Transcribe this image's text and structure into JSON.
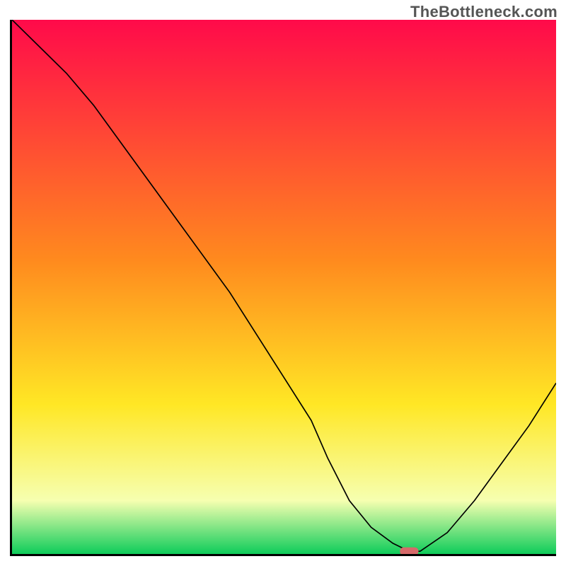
{
  "watermark": "TheBottleneck.com",
  "colors": {
    "gradient_top": "#ff0a4a",
    "gradient_mid1": "#ff8a1e",
    "gradient_mid2": "#ffe725",
    "gradient_mid3": "#f6ffb0",
    "gradient_bottom": "#0ecc5a",
    "axis": "#000000",
    "curve": "#000000",
    "marker": "#d66a6a",
    "marker_stroke": "none"
  },
  "chart_data": {
    "type": "line",
    "title": "",
    "xlabel": "",
    "ylabel": "",
    "xlim": [
      0,
      100
    ],
    "ylim": [
      0,
      100
    ],
    "x": [
      0,
      5,
      10,
      15,
      20,
      25,
      30,
      35,
      40,
      45,
      50,
      55,
      58,
      62,
      66,
      70,
      73,
      75,
      80,
      85,
      90,
      95,
      100
    ],
    "values": [
      100,
      95,
      90,
      84,
      77,
      70,
      63,
      56,
      49,
      41,
      33,
      25,
      18,
      10,
      5,
      2,
      0.5,
      0.5,
      4,
      10,
      17,
      24,
      32
    ],
    "marker": {
      "x": 73,
      "y": 0.5
    },
    "notes": "y_fraction ≈ bottleneck percentage; gradient background encodes severity (red=high, green=low). x axis unlabeled (likely hardware-balance axis)."
  }
}
